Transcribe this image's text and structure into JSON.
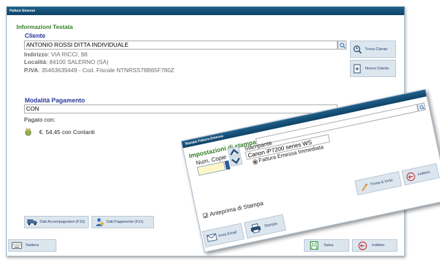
{
  "main_window": {
    "title": "Fatture Emesse",
    "section_header": "Informazioni Testata",
    "cliente": {
      "label": "Cliente",
      "name": "ANTONIO ROSSI DITTA INDIVIDUALE",
      "indirizzo_label": "Indirizzo",
      "indirizzo_value": ": VIA RICCI, 98",
      "localita_label": "Località",
      "localita_value": ": 84100 SALERNO (SA)",
      "piva_label": "P.IVA",
      "piva_value": ": 35463639449 - Cod. Fiscale NTNRSS78B65F780Z"
    },
    "buttons": {
      "trova_cliente": "Trova Cliente",
      "nuovo_cliente": "Nuovo Cliente",
      "dati_accompagnatori": "Dati Accompagnatori (F10)",
      "dati_pagamento": "Dati Pagamento (F11)",
      "tastiera": "Tastiera",
      "salva": "Salva",
      "indietro": "Indietro"
    },
    "pagamento": {
      "label": "Modalità Pagamento",
      "value": "CON",
      "pagato_con": "Pagato con:",
      "amount": "€. 54,45 con Contanti"
    }
  },
  "dialog": {
    "title": "Stampa Fattura Emessa",
    "section_header": "Impostazioni di stampa",
    "num_copie_label": "Num. Copie",
    "num_copie_value": "",
    "stampante_label": "Stampante",
    "stampante_value": "Canon iP7200 series WS",
    "radio_label": "Fattura Emessa Immediata",
    "anteprima_label": "Anteprima di Stampa",
    "buttons": {
      "firma_invia": "Firma & Invia",
      "indietro": "Indietro",
      "invia_email": "Invia Email",
      "stampa": "Stampa"
    }
  }
}
